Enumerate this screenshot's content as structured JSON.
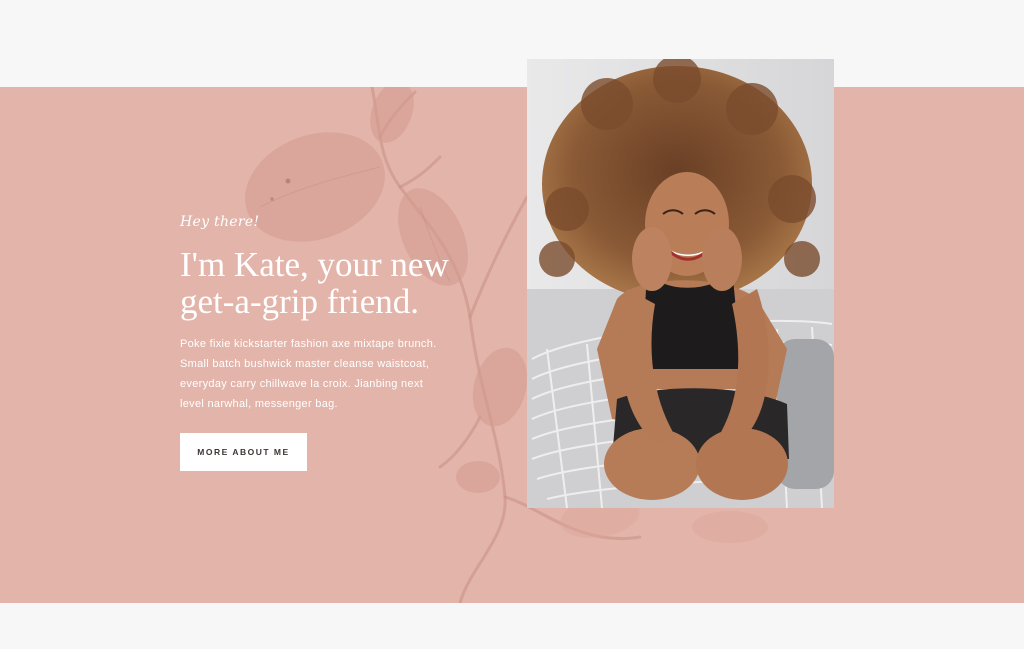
{
  "hero": {
    "greeting": "Hey there!",
    "headline": "I'm Kate, your new get-a-grip friend.",
    "blurb": "Poke fixie kickstarter fashion axe mixtape brunch. Small batch bushwick master cleanse waistcoat, everyday carry chillwave la croix. Jianbing next level narwhal, messenger bag.",
    "cta_label": "MORE ABOUT ME"
  },
  "colors": {
    "page_background": "#f7f7f8",
    "band_background": "#e3b4aa",
    "text": "#ffffff",
    "button_background": "#ffffff",
    "button_text": "#3d3533"
  },
  "icons": [
    "foliage-illustration",
    "portrait-photo"
  ]
}
